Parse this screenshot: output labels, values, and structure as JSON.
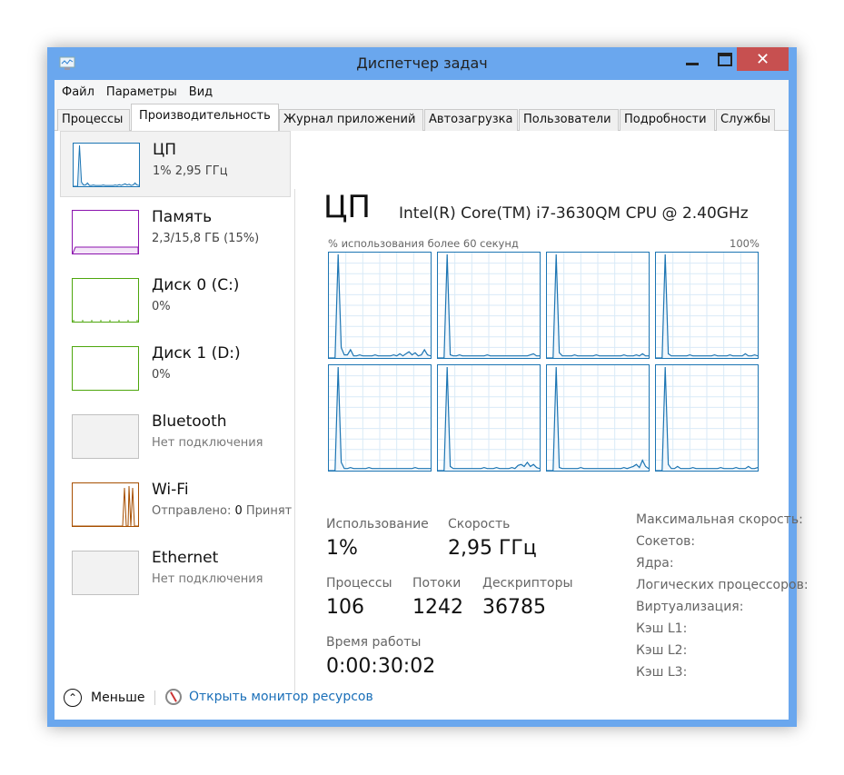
{
  "window": {
    "title": "Диспетчер задач",
    "icon": "task-manager-icon",
    "close_color": "#c75050",
    "frame_color": "#6aa7ee"
  },
  "menu": [
    "Файл",
    "Параметры",
    "Вид"
  ],
  "tabs": [
    {
      "label": "Процессы"
    },
    {
      "label": "Производительность",
      "active": true
    },
    {
      "label": "Журнал приложений"
    },
    {
      "label": "Автозагрузка"
    },
    {
      "label": "Пользователи"
    },
    {
      "label": "Подробности"
    },
    {
      "label": "Службы"
    }
  ],
  "sidebar": [
    {
      "name": "ЦП",
      "sub": "1% 2,95 ГГц",
      "color": "#1c75b3"
    },
    {
      "name": "Память",
      "sub": "2,3/15,8 ГБ (15%)",
      "color": "#8b12ae",
      "usage_pct": 15
    },
    {
      "name": "Диск 0 (C:)",
      "sub": "0%",
      "color": "#4da60c"
    },
    {
      "name": "Диск 1 (D:)",
      "sub": "0%",
      "color": "#4da60c"
    },
    {
      "name": "Bluetooth",
      "sub": "Нет подключения",
      "color": "#c0c0c0"
    },
    {
      "name": "Wi-Fi",
      "sub_label": "Отправлено:",
      "sub_value": "0",
      "sub_label2": "Принят",
      "color": "#a74f01"
    },
    {
      "name": "Ethernet",
      "sub": "Нет подключения",
      "color": "#c0c0c0"
    }
  ],
  "cpu": {
    "title": "ЦП",
    "model": "Intel(R) Core(TM) i7-3630QM CPU @ 2.40GHz",
    "graph_label": "% использования более 60 секунд",
    "graph_max": "100%",
    "line_color": "#1c75b3",
    "grid_color": "#d9eaf7",
    "cores": [
      [
        0,
        0,
        0,
        100,
        10,
        3,
        3,
        8,
        2,
        2,
        3,
        2,
        2,
        2,
        2,
        3,
        2,
        2,
        2,
        2,
        2,
        3,
        2,
        4,
        2,
        4,
        6,
        3,
        5,
        2,
        3,
        8,
        3,
        2
      ],
      [
        0,
        0,
        0,
        100,
        3,
        2,
        2,
        3,
        2,
        2,
        2,
        2,
        2,
        2,
        2,
        2,
        3,
        2,
        2,
        2,
        2,
        2,
        2,
        2,
        2,
        2,
        2,
        2,
        2,
        2,
        3,
        4,
        2,
        2
      ],
      [
        0,
        0,
        0,
        100,
        5,
        2,
        2,
        2,
        2,
        3,
        2,
        2,
        2,
        2,
        2,
        2,
        3,
        2,
        2,
        2,
        2,
        2,
        2,
        2,
        2,
        3,
        2,
        2,
        2,
        3,
        2,
        4,
        2,
        2
      ],
      [
        0,
        0,
        0,
        100,
        4,
        2,
        2,
        2,
        2,
        2,
        2,
        3,
        2,
        2,
        2,
        2,
        2,
        2,
        2,
        3,
        2,
        2,
        2,
        2,
        3,
        2,
        2,
        2,
        2,
        4,
        2,
        2,
        3,
        2
      ],
      [
        0,
        0,
        0,
        100,
        8,
        2,
        2,
        3,
        2,
        2,
        2,
        2,
        2,
        3,
        2,
        2,
        2,
        2,
        2,
        2,
        2,
        2,
        2,
        2,
        2,
        2,
        2,
        2,
        3,
        2,
        2,
        2,
        2,
        2
      ],
      [
        0,
        0,
        0,
        100,
        4,
        2,
        2,
        2,
        2,
        2,
        2,
        2,
        2,
        2,
        2,
        3,
        2,
        2,
        2,
        3,
        2,
        2,
        2,
        2,
        3,
        2,
        5,
        6,
        4,
        8,
        4,
        6,
        3,
        2
      ],
      [
        0,
        0,
        0,
        100,
        3,
        2,
        2,
        2,
        2,
        2,
        2,
        3,
        2,
        2,
        2,
        2,
        2,
        2,
        2,
        2,
        2,
        2,
        2,
        2,
        2,
        3,
        2,
        3,
        4,
        6,
        3,
        10,
        4,
        2
      ],
      [
        0,
        0,
        0,
        100,
        6,
        2,
        2,
        4,
        2,
        2,
        2,
        2,
        3,
        2,
        2,
        2,
        2,
        2,
        2,
        2,
        2,
        3,
        2,
        2,
        2,
        2,
        3,
        2,
        2,
        2,
        4,
        2,
        2,
        3
      ]
    ],
    "stats": {
      "usage_label": "Использование",
      "usage": "1%",
      "speed_label": "Скорость",
      "speed": "2,95 ГГц",
      "processes_label": "Процессы",
      "processes": "106",
      "threads_label": "Потоки",
      "threads": "1242",
      "handles_label": "Дескрипторы",
      "handles": "36785",
      "uptime_label": "Время работы",
      "uptime": "0:00:30:02"
    },
    "right_labels": [
      "Максимальная скорость:",
      "Сокетов:",
      "Ядра:",
      "Логических процессоров:",
      "Виртуализация:",
      "Кэш L1:",
      "Кэш L2:",
      "Кэш L3:"
    ]
  },
  "bottom": {
    "less": "Меньше",
    "monitor": "Открыть монитор ресурсов"
  }
}
